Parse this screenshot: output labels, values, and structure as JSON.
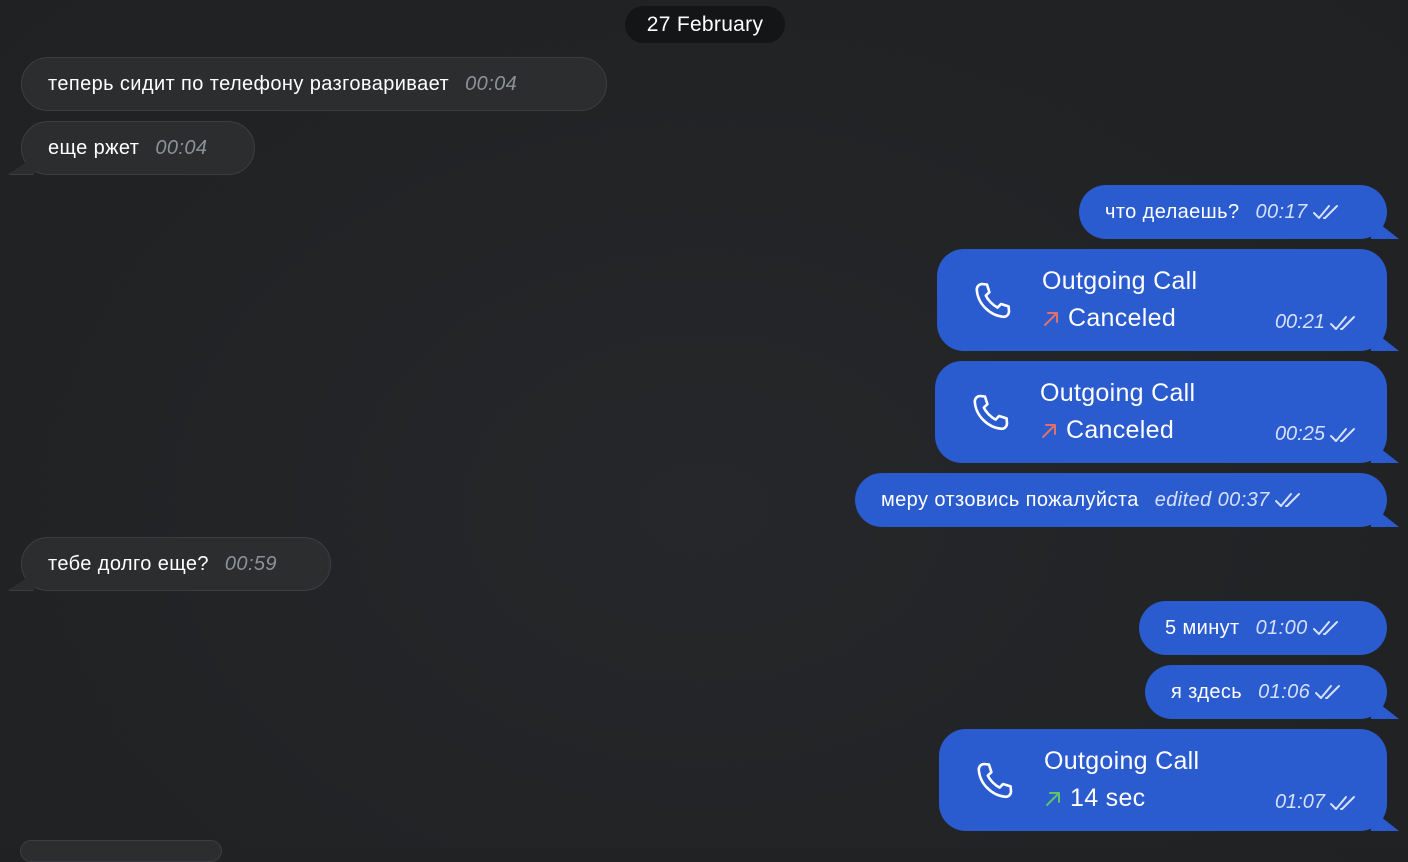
{
  "date_separator": "27 February",
  "messages": [
    {
      "text": "теперь сидит по телефону разговаривает",
      "time": "00:04"
    },
    {
      "text": "еще ржет",
      "time": "00:04"
    },
    {
      "text": "что делаешь?",
      "time": "00:17"
    },
    {
      "title": "Outgoing Call",
      "status": "Canceled",
      "time": "00:21"
    },
    {
      "title": "Outgoing Call",
      "status": "Canceled",
      "time": "00:25"
    },
    {
      "text": "меру отзовись пожалуйста",
      "edited": "edited",
      "time": "00:37"
    },
    {
      "text": "тебе долго еще?",
      "time": "00:59"
    },
    {
      "text": "5 минут",
      "time": "01:00"
    },
    {
      "text": "я здесь",
      "time": "01:06"
    },
    {
      "title": "Outgoing Call",
      "status": "14 sec",
      "time": "01:07"
    }
  ],
  "colors": {
    "outgoing_bubble": "#2a5bcf",
    "incoming_bubble": "#2b2d2f",
    "canceled_arrow": "#e0706a",
    "answered_arrow": "#5cc46a"
  },
  "icons": [
    "phone-icon",
    "double-check-icon",
    "arrow-up-right-icon"
  ]
}
